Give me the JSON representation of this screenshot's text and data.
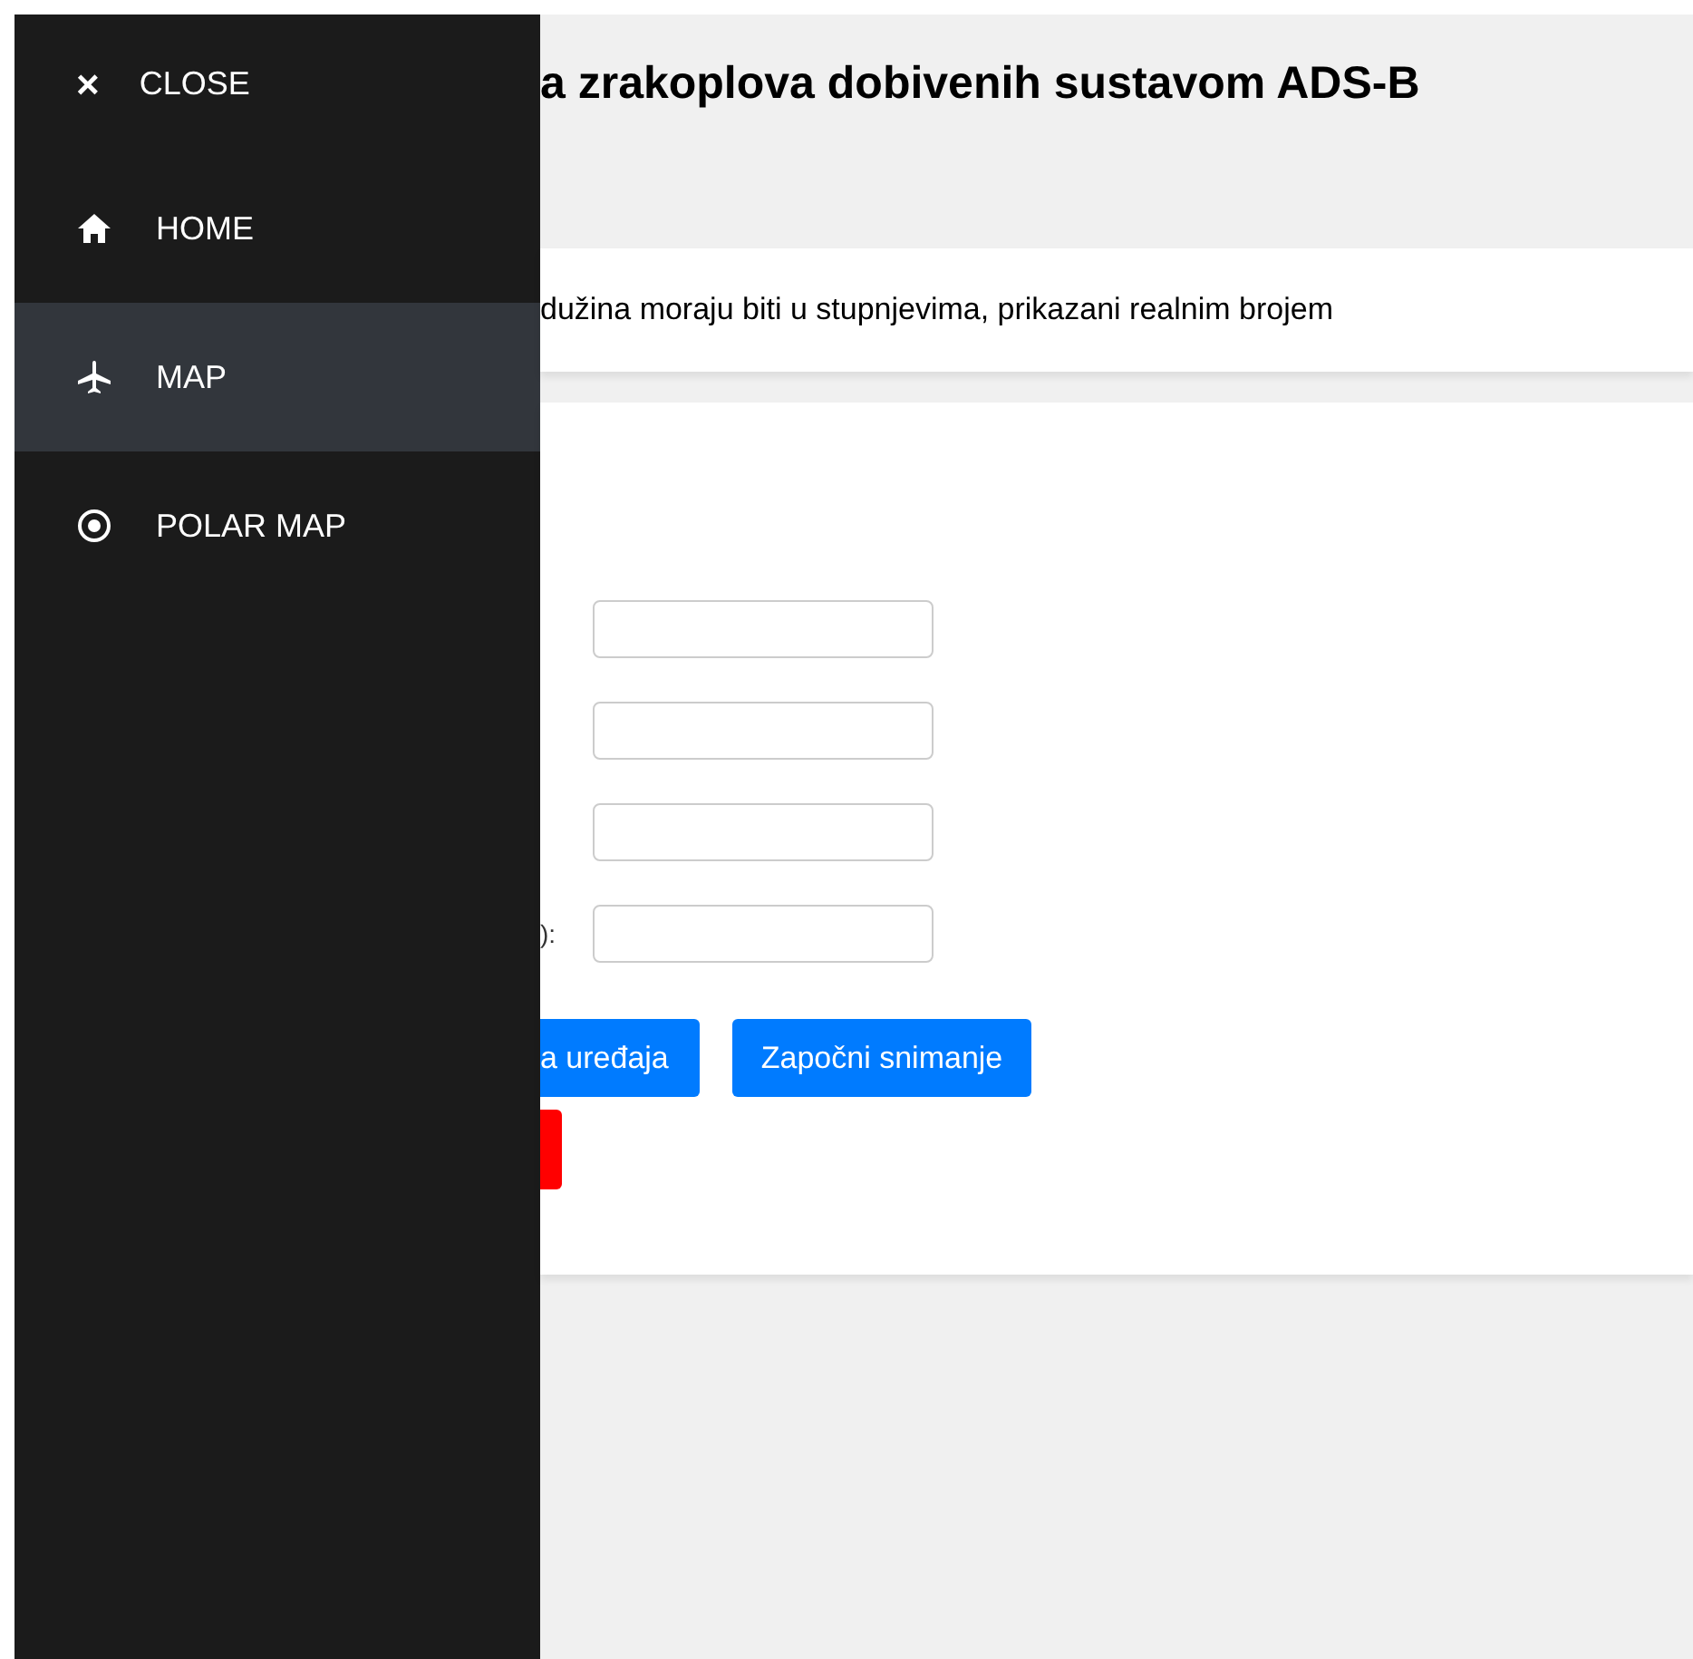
{
  "sidebar": {
    "close": {
      "icon": "×",
      "label": "CLOSE"
    },
    "items": [
      {
        "label": "HOME",
        "kind": "home",
        "selected": false
      },
      {
        "label": "MAP",
        "kind": "plane",
        "selected": true
      },
      {
        "label": "POLAR MAP",
        "kind": "target",
        "selected": false
      }
    ]
  },
  "header": {
    "title": "a zrakoplova dobivenih sustavom ADS-B"
  },
  "notice": {
    "text": "dužina moraju biti u stupnjevima, prikazani realnim brojem"
  },
  "form": {
    "fields": [
      {
        "kind": "input"
      },
      {
        "kind": "input"
      },
      {
        "kind": "input"
      },
      {
        "kind": "input",
        "label": "):"
      }
    ],
    "buttons": [
      {
        "kind": "primary",
        "label": "a uređaja"
      },
      {
        "kind": "primary",
        "label": "Započni snimanje"
      },
      {
        "kind": "danger"
      }
    ]
  }
}
